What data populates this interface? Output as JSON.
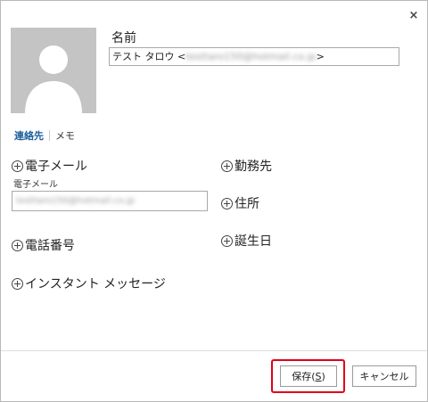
{
  "dialog": {
    "close_glyph": "×"
  },
  "contact": {
    "name_label": "名前",
    "name_prefix": "テスト タロウ <",
    "name_email_blurred": "testtaro150@hotmail.co.jp",
    "name_suffix": ">"
  },
  "tabs": [
    {
      "label": "連絡先",
      "active": true
    },
    {
      "label": "メモ",
      "active": false
    }
  ],
  "fields": {
    "email_add_label": "電子メール",
    "email_sub_label": "電子メール",
    "email_value_blurred": "testtaro150@hotmail.co.jp",
    "phone_add_label": "電話番号",
    "im_add_label": "インスタント メッセージ",
    "work_add_label": "勤務先",
    "address_add_label": "住所",
    "birthday_add_label": "誕生日"
  },
  "footer": {
    "save_label": "保存",
    "save_accel_open": "(",
    "save_accel_key": "S",
    "save_accel_close": ")",
    "cancel_label": "キャンセル"
  },
  "colors": {
    "accent": "#1f5f9c",
    "highlight": "#e0001b",
    "avatar_bg": "#c4c4c4"
  }
}
